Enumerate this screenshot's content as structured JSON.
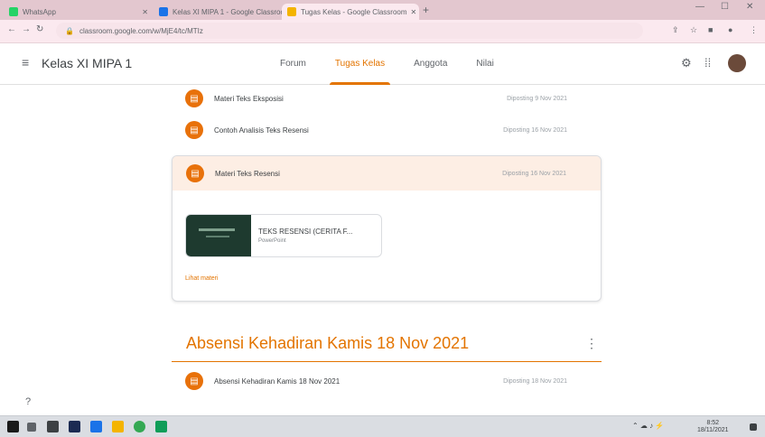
{
  "browser": {
    "tabs": [
      {
        "label": "WhatsApp",
        "favicon_color": "#25d366"
      },
      {
        "label": "Kelas XI MIPA 1 - Google Classroom",
        "favicon_color": "#1a73e8"
      },
      {
        "label": "Tugas Kelas - Google Classroom",
        "favicon_color": "#f4b400",
        "active": true
      }
    ],
    "new_tab_icon": "plus-icon",
    "url": "classroom.google.com/w/MjE4/tc/MTIz",
    "window_controls": [
      "minimize-icon",
      "maximize-icon",
      "close-icon"
    ]
  },
  "header": {
    "class_name": "Kelas XI MIPA 1",
    "tabs": [
      {
        "label": "Forum",
        "active": false
      },
      {
        "label": "Tugas Kelas",
        "active": true
      },
      {
        "label": "Anggota",
        "active": false
      },
      {
        "label": "Nilai",
        "active": false
      }
    ],
    "accent": "#e37400"
  },
  "materials": {
    "row1": {
      "title": "Materi Teks Eksposisi",
      "date": "Diposting 9 Nov 2021"
    },
    "row2": {
      "title": "Contoh Analisis Teks Resensi",
      "date": "Diposting 16 Nov 2021"
    },
    "expanded": {
      "title": "Materi Teks Resensi",
      "date": "Diposting 16 Nov 2021",
      "attachment_name": "TEKS RESENSI (CERITA F...",
      "attachment_type": "PowerPoint",
      "view_link": "Lihat materi"
    }
  },
  "topic": {
    "title": "Absensi Kehadiran Kamis 18 Nov 2021",
    "more_icon": "more-vert-icon",
    "row": {
      "title": "Absensi Kehadiran Kamis 18 Nov 2021",
      "date": "Diposting 18 Nov 2021"
    }
  },
  "taskbar": {
    "apps": [
      "windows-icon",
      "search-icon",
      "store-icon",
      "shield-icon",
      "explorer-icon",
      "folder-icon",
      "chrome-icon",
      "photos-icon"
    ],
    "tray": {
      "time": "8:52",
      "date": "18/11/2021"
    }
  }
}
